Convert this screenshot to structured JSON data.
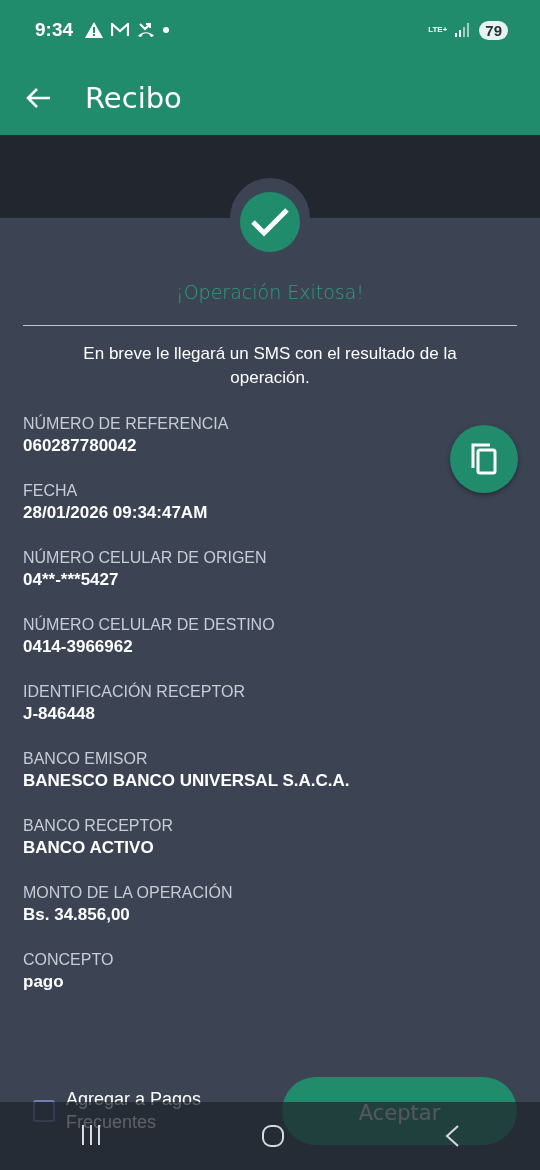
{
  "status_bar": {
    "time": "9:34",
    "network": "LTE+",
    "battery": "79"
  },
  "app_bar": {
    "title": "Recibo"
  },
  "result": {
    "message": "¡Operación Exitosa!",
    "notice": "En breve le llegará un SMS con el resultado de la operación."
  },
  "fields": [
    {
      "label": "NÚMERO DE REFERENCIA",
      "value": "060287780042"
    },
    {
      "label": "FECHA",
      "value": "28/01/2026 09:34:47AM"
    },
    {
      "label": "NÚMERO CELULAR DE ORIGEN",
      "value": "04**-***5427"
    },
    {
      "label": "NÚMERO CELULAR DE DESTINO",
      "value": "0414-3966962"
    },
    {
      "label": "IDENTIFICACIÓN RECEPTOR",
      "value": "J-846448"
    },
    {
      "label": "BANCO EMISOR",
      "value": "BANESCO BANCO UNIVERSAL S.A.C.A."
    },
    {
      "label": "BANCO RECEPTOR",
      "value": "BANCO ACTIVO"
    },
    {
      "label": "MONTO DE LA OPERACIÓN",
      "value": "Bs. 34.856,00"
    },
    {
      "label": "CONCEPTO",
      "value": "pago"
    }
  ],
  "footer": {
    "checkbox": {
      "label": "Agregar a Pagos Frecuentes",
      "checked": false
    },
    "button": "Aceptar"
  }
}
